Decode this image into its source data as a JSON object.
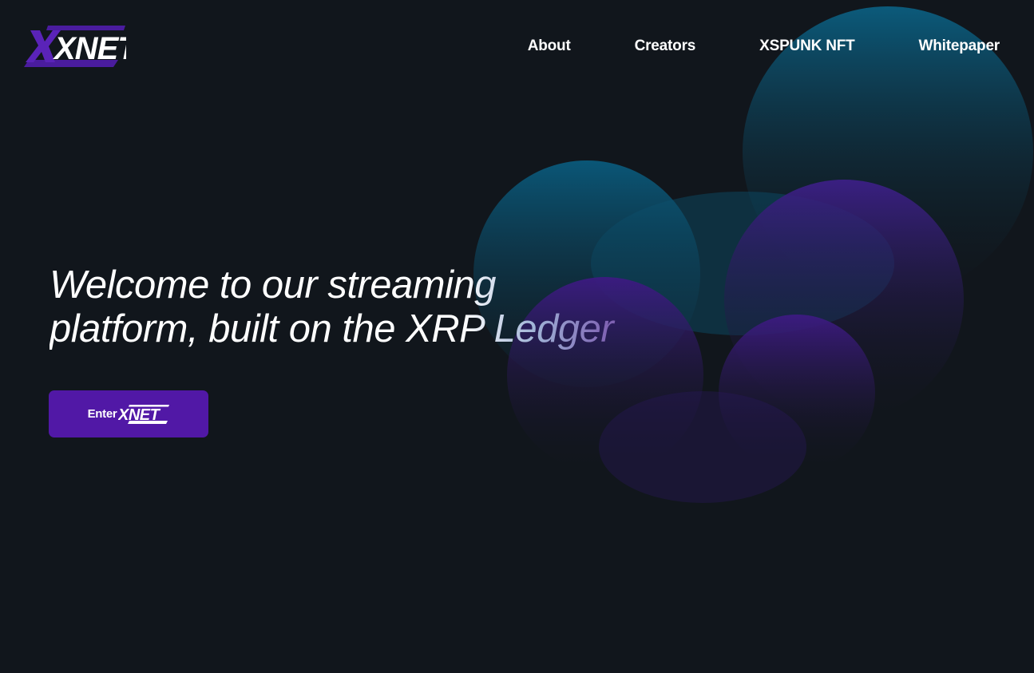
{
  "brand": {
    "logo_text": "XNET",
    "accent_color": "#5118a6",
    "teal_color": "#0c5a78",
    "background_color": "#11161c"
  },
  "nav": {
    "items": [
      {
        "label": "About"
      },
      {
        "label": "Creators"
      },
      {
        "label": "XSPUNK NFT"
      },
      {
        "label": "Whitepaper"
      }
    ]
  },
  "hero": {
    "headline_line1": "Welcome to our streaming",
    "headline_line2": "platform, built on the XRP Ledger",
    "cta_label": "Enter",
    "cta_logo_text": "XNET"
  }
}
